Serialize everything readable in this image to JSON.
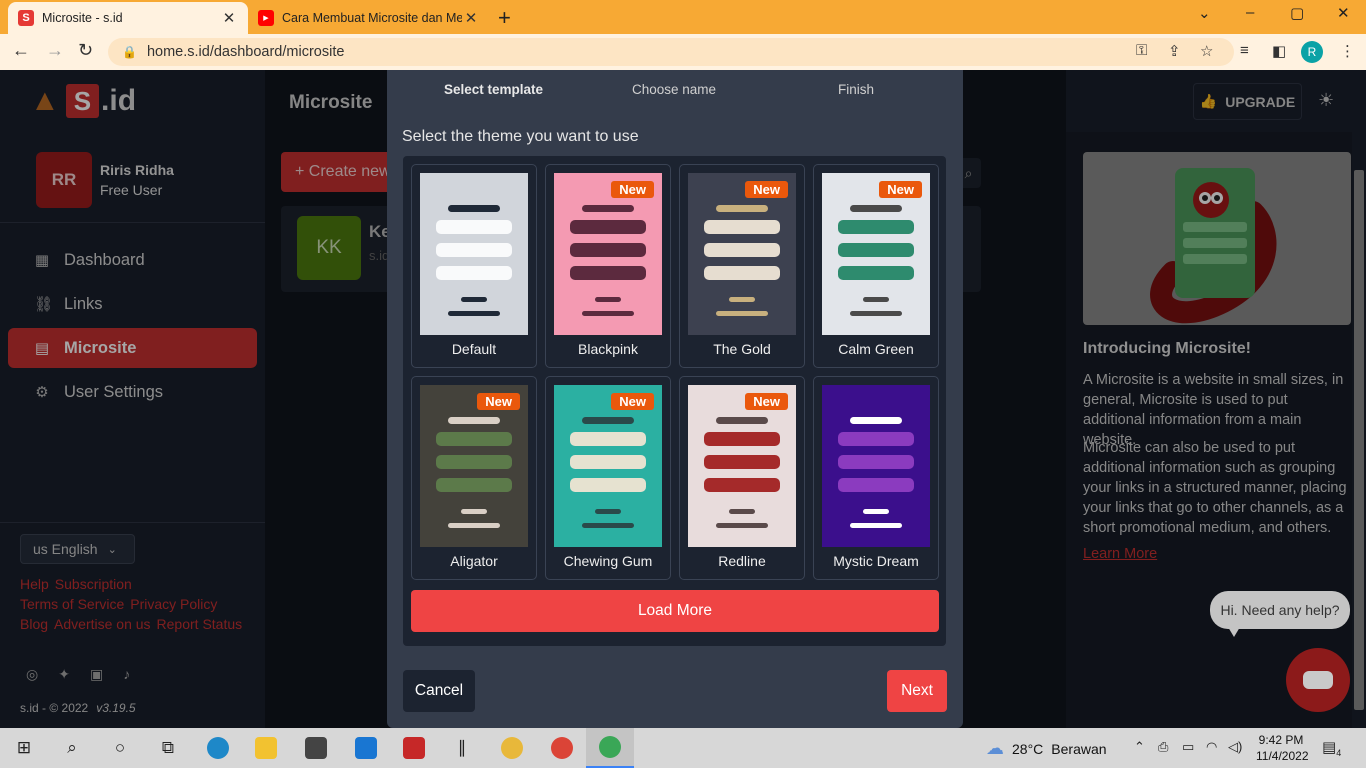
{
  "browser": {
    "tabs": [
      {
        "favicon": "S",
        "title": "Microsite - s.id",
        "close": "✕"
      },
      {
        "favicon": "▶",
        "title": "Cara Membuat Microsite dan Me",
        "close": "✕"
      }
    ],
    "new_tab": "+",
    "window_controls": [
      "⌄",
      "–",
      "▢",
      "✕"
    ],
    "url": "home.s.id/dashboard/microsite",
    "profile_initial": "R"
  },
  "sidebar": {
    "logo_text": "S",
    "logo_suffix": ".id",
    "user": {
      "initials": "RR",
      "name": "Riris Ridha",
      "role": "Free User"
    },
    "nav": [
      {
        "label": "Dashboard",
        "icon": "dashboard-icon"
      },
      {
        "label": "Links",
        "icon": "link-icon"
      },
      {
        "label": "Microsite",
        "icon": "microsite-icon"
      },
      {
        "label": "User Settings",
        "icon": "gear-icon"
      }
    ],
    "language": "us English",
    "footer_links": [
      "Help",
      "Subscription",
      "Terms of Service",
      "Privacy Policy",
      "Blog",
      "Advertise on us",
      "Report Status"
    ],
    "copyright": "s.id - © 2022",
    "version": "v3.19.5"
  },
  "main": {
    "title": "Microsite",
    "create_button": "+ Create new",
    "card": {
      "initials": "KK",
      "title": "Ke",
      "subtitle": "s.id"
    }
  },
  "header": {
    "upgrade": "UPGRADE"
  },
  "modal": {
    "steps": [
      "Select template",
      "Choose name",
      "Finish"
    ],
    "subtitle": "Select the theme you want to use",
    "badge_text": "New",
    "templates": [
      {
        "name": "Default",
        "is_new": false,
        "bg": "#d1d5db",
        "title_color": "#1f2937",
        "btn_color": "#f9fafb",
        "footer_color": "#1f2937"
      },
      {
        "name": "Blackpink",
        "is_new": true,
        "bg": "#f49ab2",
        "title_color": "#5c2a3e",
        "btn_color": "#5c2a3e",
        "footer_color": "#5c2a3e"
      },
      {
        "name": "The Gold",
        "is_new": true,
        "bg": "#3d4150",
        "title_color": "#c8b07e",
        "btn_color": "#e6ddd0",
        "footer_color": "#c8b07e"
      },
      {
        "name": "Calm Green",
        "is_new": true,
        "bg": "#e2e5ea",
        "title_color": "#4a4a4a",
        "btn_color": "#2e8b6e",
        "footer_color": "#4a4a4a"
      },
      {
        "name": "Aligator",
        "is_new": true,
        "bg": "#44423b",
        "title_color": "#d9cfc5",
        "btn_color": "#5c7a4a",
        "footer_color": "#d9cfc5"
      },
      {
        "name": "Chewing Gum",
        "is_new": true,
        "bg": "#2bb0a2",
        "title_color": "#2a4a4a",
        "btn_color": "#e6e2d0",
        "footer_color": "#2a4a4a"
      },
      {
        "name": "Redline",
        "is_new": true,
        "bg": "#e8dcdc",
        "title_color": "#5a4a4a",
        "btn_color": "#a52a2a",
        "footer_color": "#5a4a4a"
      },
      {
        "name": "Mystic Dream",
        "is_new": false,
        "bg": "#3b0f8c",
        "title_color": "#ffffff",
        "btn_color": "#8b3bbf",
        "footer_color": "#ffffff"
      }
    ],
    "load_more": "Load More",
    "cancel": "Cancel",
    "next": "Next"
  },
  "right_panel": {
    "title": "Introducing Microsite!",
    "paragraphs": [
      "A Microsite is a website in small sizes, in general, Microsite is used to put additional information from a main website.",
      "Microsite can also be used to put additional information such as grouping your links in a structured manner, placing your links that go to other channels, as a short promotional medium, and others."
    ],
    "learn_more": "Learn More",
    "help_bubble": "Hi. Need any help?"
  },
  "taskbar": {
    "weather_temp": "28°C",
    "weather_text": "Berawan",
    "time": "9:42 PM",
    "date": "11/4/2022",
    "notifications": "4"
  }
}
